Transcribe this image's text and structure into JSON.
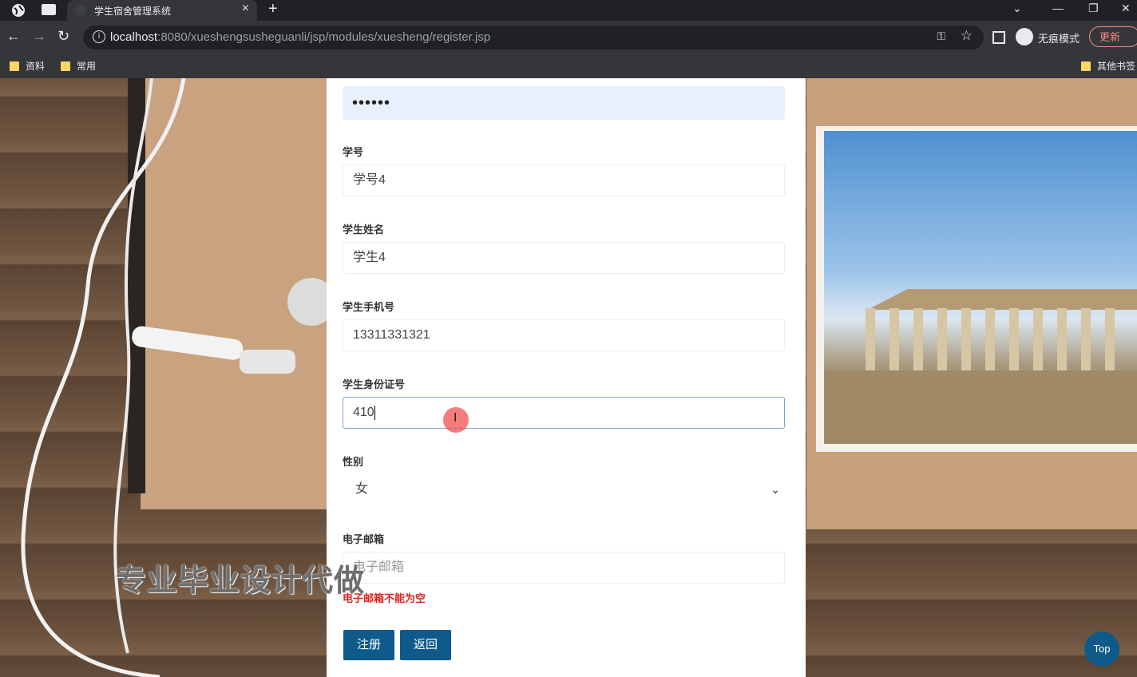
{
  "browser": {
    "tab_title": "学生宿舍管理系统",
    "url_host": "localhost",
    "url_rest": ":8080/xueshengsusheguanli/jsp/modules/xuesheng/register.jsp",
    "incognito_label": "无痕模式",
    "update_label": "更新",
    "bookmarks": [
      "资料",
      "常用"
    ],
    "other_bookmarks": "其他书签"
  },
  "form": {
    "password_value": "••••••",
    "fields": [
      {
        "label": "学号",
        "value": "学号4"
      },
      {
        "label": "学生姓名",
        "value": "学生4"
      },
      {
        "label": "学生手机号",
        "value": "13311331321"
      },
      {
        "label": "学生身份证号",
        "value": "410"
      }
    ],
    "gender": {
      "label": "性别",
      "selected": "女"
    },
    "email": {
      "label": "电子邮箱",
      "placeholder": "电子邮箱",
      "error": "电子邮箱不能为空"
    },
    "register_button": "注册",
    "back_button": "返回"
  },
  "watermark": "专业毕业设计代做",
  "top_button": "Top"
}
